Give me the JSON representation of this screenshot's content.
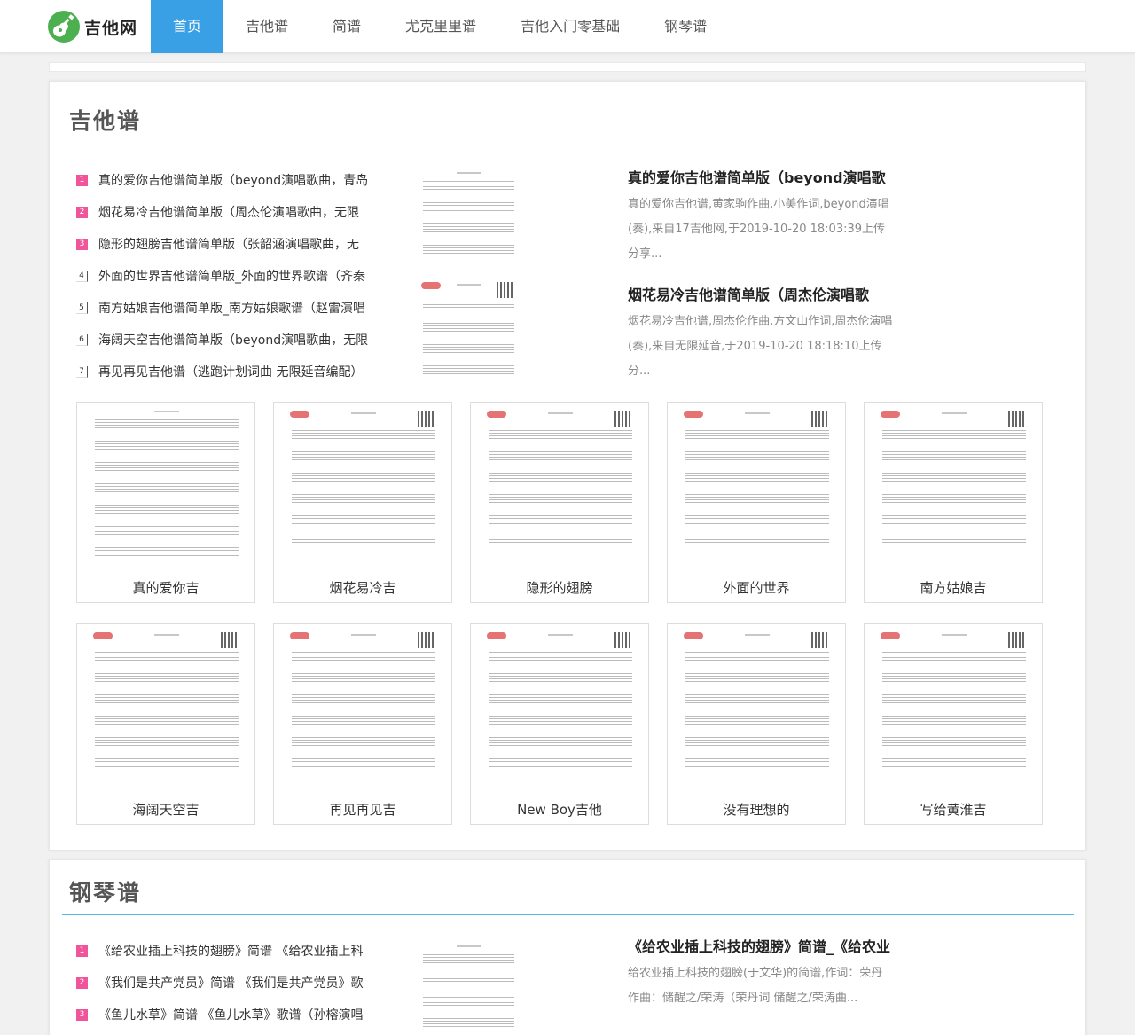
{
  "site": {
    "logo_text": "吉他网",
    "logo_icon": "guitar-icon",
    "accent": "#3aa0e6",
    "rank_color": "#f0559a"
  },
  "nav": [
    {
      "label": "首页",
      "active": true
    },
    {
      "label": "吉他谱",
      "active": false
    },
    {
      "label": "简谱",
      "active": false
    },
    {
      "label": "尤克里里谱",
      "active": false
    },
    {
      "label": "吉他入门零基础",
      "active": false
    },
    {
      "label": "钢琴谱",
      "active": false
    }
  ],
  "guitar": {
    "title": "吉他谱",
    "list": [
      {
        "num": "1",
        "text": "真的爱你吉他谱简单版（beyond演唱歌曲，青岛"
      },
      {
        "num": "2",
        "text": "烟花易冷吉他谱简单版（周杰伦演唱歌曲，无限"
      },
      {
        "num": "3",
        "text": "隐形的翅膀吉他谱简单版（张韶涵演唱歌曲，无"
      },
      {
        "num": "4",
        "text": "外面的世界吉他谱简单版_外面的世界歌谱（齐秦"
      },
      {
        "num": "5",
        "text": "南方姑娘吉他谱简单版_南方姑娘歌谱（赵雷演唱"
      },
      {
        "num": "6",
        "text": "海阔天空吉他谱简单版（beyond演唱歌曲，无限"
      },
      {
        "num": "7",
        "text": "再见再见吉他谱（逃跑计划词曲 无限延音编配）"
      }
    ],
    "features": [
      {
        "title": "真的爱你吉他谱简单版（beyond演唱歌",
        "desc": "真的爱你吉他谱,黄家驹作曲,小美作词,beyond演唱(奏),来自17吉他网,于2019-10-20 18:03:39上传分享..."
      },
      {
        "title": "烟花易冷吉他谱简单版（周杰伦演唱歌",
        "desc": "烟花易冷吉他谱,周杰伦作曲,方文山作词,周杰伦演唱(奏),来自无限延音,于2019-10-20 18:18:10上传分..."
      }
    ],
    "tiles": [
      {
        "caption": "真的爱你吉"
      },
      {
        "caption": "烟花易冷吉"
      },
      {
        "caption": "隐形的翅膀"
      },
      {
        "caption": "外面的世界"
      },
      {
        "caption": "南方姑娘吉"
      },
      {
        "caption": "海阔天空吉"
      },
      {
        "caption": "再见再见吉"
      },
      {
        "caption": "New Boy吉他"
      },
      {
        "caption": "没有理想的"
      },
      {
        "caption": "写给黄淮吉"
      }
    ]
  },
  "piano": {
    "title": "钢琴谱",
    "list": [
      {
        "num": "1",
        "text": "《给农业插上科技的翅膀》简谱 《给农业插上科"
      },
      {
        "num": "2",
        "text": "《我们是共产党员》简谱 《我们是共产党员》歌"
      },
      {
        "num": "3",
        "text": "《鱼儿水草》简谱 《鱼儿水草》歌谱（孙榕演唱"
      }
    ],
    "features": [
      {
        "title": "《给农业插上科技的翅膀》简谱_《给农业",
        "desc": "给农业插上科技的翅膀(于文华)的简谱,作词：荣丹 作曲：储醒之/荣涛（荣丹词 储醒之/荣涛曲..."
      }
    ]
  }
}
